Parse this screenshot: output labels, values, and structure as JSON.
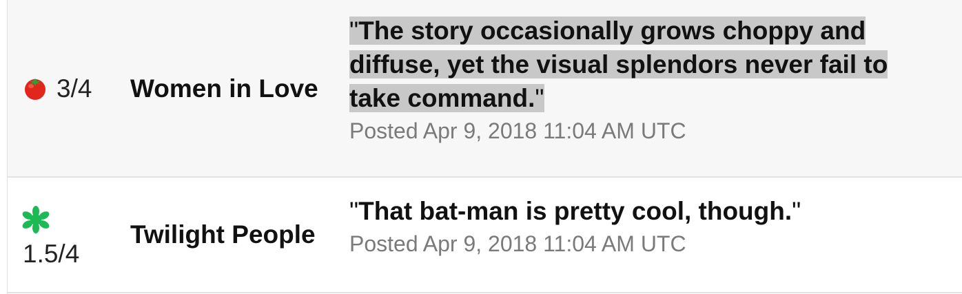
{
  "reviews": [
    {
      "icon": "tomato-icon",
      "score": "3/4",
      "title": "Women in Love",
      "quote_open": "\"",
      "quote_text": "The story occasionally grows choppy and diffuse, yet the visual splendors never fail to take command.",
      "quote_close": "\"",
      "posted": "Posted Apr 9, 2018 11:04 AM UTC"
    },
    {
      "icon": "green-splat-icon",
      "score": "1.5/4",
      "title": "Twilight People",
      "quote_open": "\"",
      "quote_text": "That bat-man is pretty cool, though.",
      "quote_close": "\"",
      "posted": "Posted Apr 9, 2018 11:04 AM UTC"
    }
  ],
  "colors": {
    "tomato_red": "#e3261b",
    "splat_green": "#1db954",
    "highlight": "#c8c8c8"
  }
}
